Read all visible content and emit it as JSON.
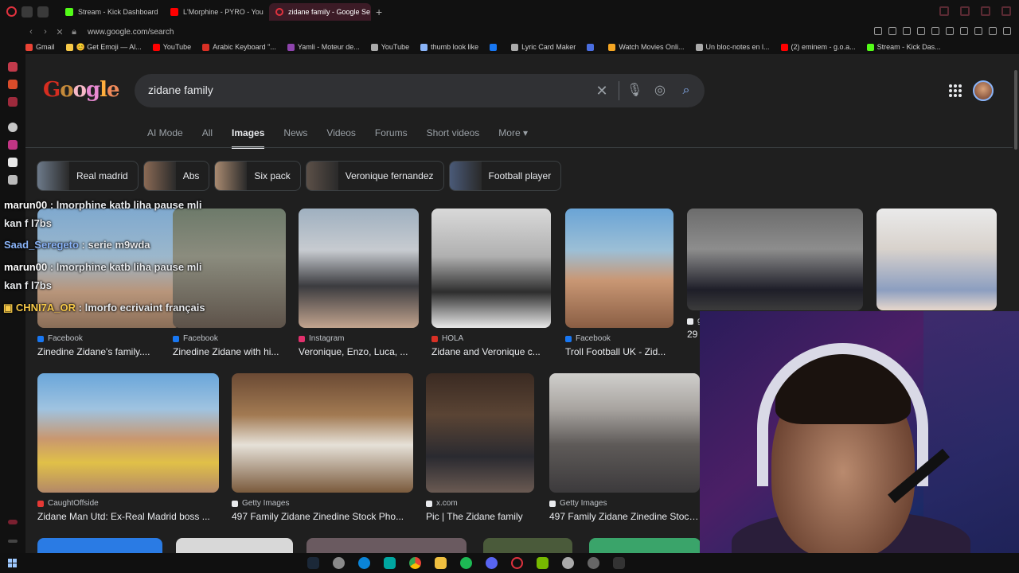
{
  "browser": {
    "tabs": [
      {
        "title": "Stream - Kick Dashboard",
        "color": "#53fc18",
        "active": false
      },
      {
        "title": "L'Morphine - PYRO - You",
        "color": "#ff0000",
        "active": false
      },
      {
        "title": "zidane family - Google Se",
        "color": "#e0323e",
        "active": true
      }
    ],
    "new_tab": "+",
    "url": "www.google.com/search",
    "bookmarks": [
      {
        "label": "Gmail",
        "color": "#ea4335"
      },
      {
        "label": "😊 Get Emoji — Al...",
        "color": "#f7c948"
      },
      {
        "label": "YouTube",
        "color": "#ff0000"
      },
      {
        "label": "Arabic Keyboard \"...",
        "color": "#d93025"
      },
      {
        "label": "Yamli - Moteur de...",
        "color": "#8e44ad"
      },
      {
        "label": "YouTube",
        "color": "#aaaaaa"
      },
      {
        "label": "thumb look like",
        "color": "#8ab4f8"
      },
      {
        "label": "",
        "color": "#1877f2"
      },
      {
        "label": "Lyric Card Maker",
        "color": "#aaaaaa"
      },
      {
        "label": "",
        "color": "#4a6ee0"
      },
      {
        "label": "Watch Movies Onli...",
        "color": "#f5a623"
      },
      {
        "label": "Un bloc-notes en l...",
        "color": "#aaaaaa"
      },
      {
        "label": "(2) eminem - g.o.a...",
        "color": "#ff0000"
      },
      {
        "label": "Stream - Kick Das...",
        "color": "#53fc18"
      }
    ]
  },
  "google": {
    "logo": "Google",
    "query": "zidane family",
    "filters": [
      {
        "label": "AI Mode",
        "active": false
      },
      {
        "label": "All",
        "active": false
      },
      {
        "label": "Images",
        "active": true
      },
      {
        "label": "News",
        "active": false
      },
      {
        "label": "Videos",
        "active": false
      },
      {
        "label": "Forums",
        "active": false
      },
      {
        "label": "Short videos",
        "active": false
      },
      {
        "label": "More ▾",
        "active": false
      }
    ],
    "chips": [
      {
        "label": "Real madrid",
        "thumb": "#6d7a8a"
      },
      {
        "label": "Abs",
        "thumb": "#8a6a55"
      },
      {
        "label": "Six pack",
        "thumb": "#a98a70"
      },
      {
        "label": "Veronique fernandez",
        "thumb": "#5c5048"
      },
      {
        "label": "Football player",
        "thumb": "#4a5a78"
      }
    ],
    "results_row1": [
      {
        "source": "Facebook",
        "title": "Zinedine Zidane's family....",
        "src_color": "#1877f2",
        "img": "linear-gradient(180deg,#7fa9cf 0%,#9bb7cc 40%,#b8957a 70%,#8a6e58 100%)"
      },
      {
        "source": "Facebook",
        "title": "Zinedine Zidane with hi...",
        "src_color": "#1877f2",
        "img": "linear-gradient(180deg,#6d7a6a 0%,#8b8c7e 40%,#5d5249 100%)"
      },
      {
        "source": "Instagram",
        "title": "Veronique, Enzo, Luca, ...",
        "src_color": "#e1306c",
        "img": "linear-gradient(180deg,#9fb0c0 0%,#c7cbd0 35%,#3b3b3f 65%,#c2a48e 100%)"
      },
      {
        "source": "HOLA",
        "title": "Zidane and Veronique c...",
        "src_color": "#d93025",
        "img": "linear-gradient(180deg,#d9d9d9 0%,#b0b0b0 40%,#2e2e2e 70%,#e8e8e8 100%)"
      },
      {
        "source": "Facebook",
        "title": "Troll Football UK - Zid...",
        "src_color": "#1877f2",
        "img": "linear-gradient(180deg,#6aa4d6 0%,#9cbfd6 35%,#c99774 60%,#8a5e44 100%)"
      },
      {
        "source": "g",
        "title": "29",
        "src_color": "#e8eaed",
        "img": "linear-gradient(180deg,#6c6c6c 0%,#8d8d8d 40%,#1e1e28 80%,#3c3c3c 100%)"
      },
      {
        "source": "",
        "title": "",
        "src_color": "#1f1f1f",
        "img": "linear-gradient(180deg,#eaeaea 0%,#d8d2cc 40%,#8c9ec0 80%,#e8d8cc 100%)"
      }
    ],
    "results_row2": [
      {
        "source": "CaughtOffside",
        "title": "Zidane Man Utd: Ex-Real Madrid boss ...",
        "src_color": "#e53935",
        "img": "linear-gradient(180deg,#6aa6da 0%,#9fc3e0 30%,#c9976f 55%,#e0c048 75%,#b38868 100%)"
      },
      {
        "source": "Getty Images",
        "title": "497 Family Zidane Zinedine Stock Pho...",
        "src_color": "#e8eaed",
        "img": "linear-gradient(180deg,#6b4a34 0%,#a27a52 35%,#e6e1d8 60%,#7a5a3c 100%)"
      },
      {
        "source": "x.com",
        "title": "Pic | The Zidane family",
        "src_color": "#e8eaed",
        "img": "linear-gradient(180deg,#3a2a22 0%,#5a4434 35%,#2a2a30 70%,#6a5a52 100%)"
      },
      {
        "source": "Getty Images",
        "title": "497 Family Zidane Zinedine Stock...",
        "src_color": "#e8eaed",
        "img": "linear-gradient(180deg,#d0cfcc 0%,#a8a4a0 30%,#5e5a58 60%,#3c3a3c 100%)"
      }
    ],
    "results_row3_colors": [
      "#2a7be4",
      "#d8d8d8",
      "#6a5a60",
      "#4a5a3a",
      "#3aa46a"
    ]
  },
  "chat": [
    {
      "user": "marun00",
      "user_color": "#ffffff",
      "text": " : lmorphine katb liha pause mli"
    },
    {
      "user": "",
      "user_color": "#ffffff",
      "text": "kan f l7bs"
    },
    {
      "user": "Saad_Seregeto",
      "user_color": "#8ab4f8",
      "text": " : serie m9wda"
    },
    {
      "user": "marun00",
      "user_color": "#ffffff",
      "text": " : lmorphine katb liha pause mli"
    },
    {
      "user": "",
      "user_color": "#ffffff",
      "text": "kan f l7bs"
    },
    {
      "user": "CHNI7A_OR",
      "user_color": "#f7c948",
      "text": " : lmorfo ecrivaint français"
    }
  ],
  "colors": {
    "accent": "#8ab4f8",
    "background": "#1f1f1f",
    "opera_red": "#e0323e"
  }
}
